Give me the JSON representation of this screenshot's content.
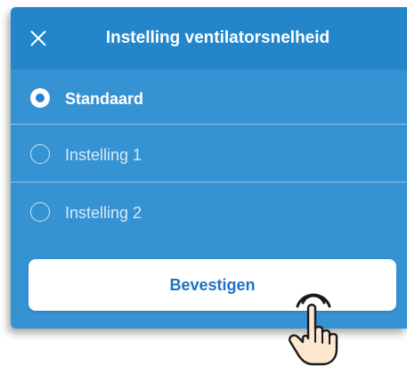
{
  "dialog": {
    "title": "Instelling ventilatorsnelheid",
    "close_icon": "close-icon",
    "options": [
      {
        "label": "Standaard",
        "selected": true
      },
      {
        "label": "Instelling 1",
        "selected": false
      },
      {
        "label": "Instelling 2",
        "selected": false
      }
    ],
    "confirm_label": "Bevestigen"
  },
  "colors": {
    "header": "#2386cb",
    "body": "#3693d3",
    "button_text": "#1c72c4"
  },
  "overlay": {
    "icon": "hand-pointer-icon"
  }
}
